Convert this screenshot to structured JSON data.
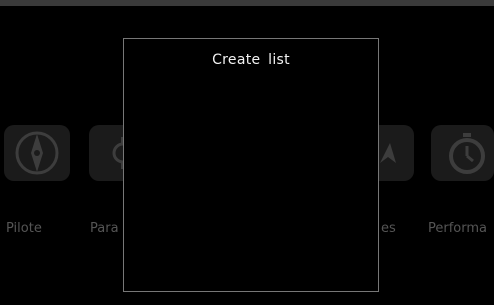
{
  "status_bar": {},
  "background_apps": [
    {
      "label": "Pilote",
      "icon": "compass-icon"
    },
    {
      "label": "Para",
      "icon": "gear-icon"
    },
    {
      "label": "es",
      "icon": "navigation-icon"
    },
    {
      "label": "Performa",
      "icon": "stopwatch-icon"
    }
  ],
  "dialog": {
    "title": "Create  list"
  },
  "colors": {
    "background": "#000000",
    "tile": "#1b1b1b",
    "dim_text": "#555555",
    "dialog_border": "#777777",
    "title_text": "#f2f2f2"
  }
}
